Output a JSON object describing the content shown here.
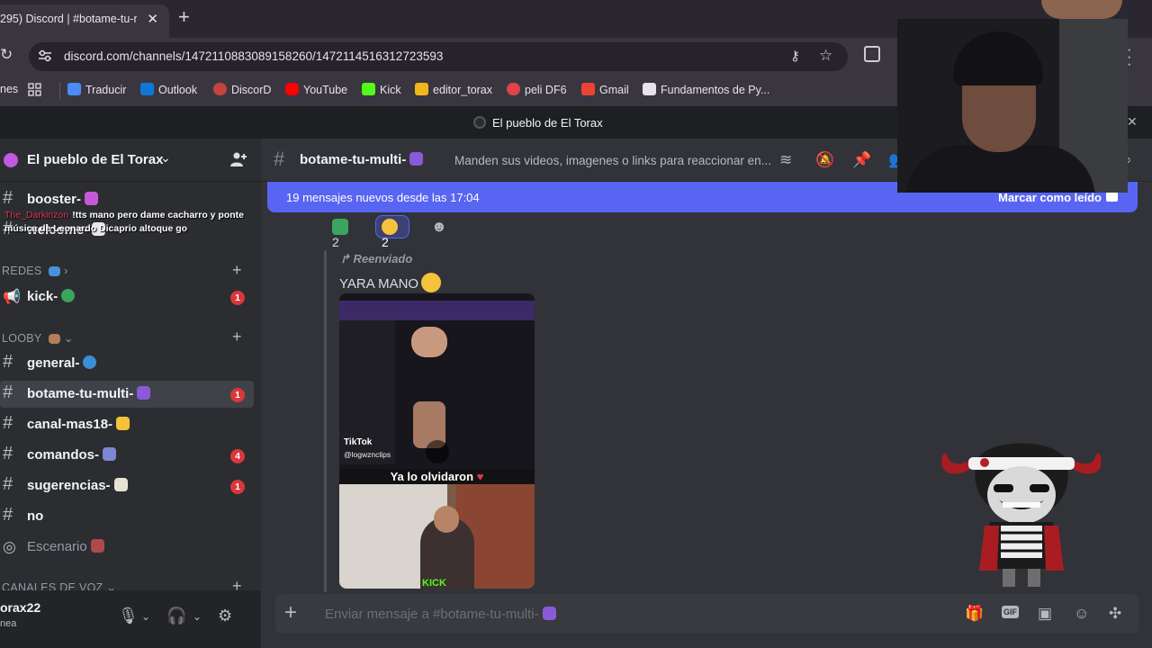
{
  "browser": {
    "tab_title": "295) Discord | #botame-tu-m",
    "url": "discord.com/channels/1472110883089158260/1472114516312723593",
    "bookmarks": [
      {
        "label": "nes",
        "color": "#3a3640"
      },
      {
        "label": "Traducir",
        "color": "#4c8bf5"
      },
      {
        "label": "Outlook",
        "color": "#0f78d4"
      },
      {
        "label": "DiscorD",
        "color": "#c4443d"
      },
      {
        "label": "YouTube",
        "color": "#ff0000"
      },
      {
        "label": "Kick",
        "color": "#53fc18"
      },
      {
        "label": "editor_torax",
        "color": "#f2b61c"
      },
      {
        "label": "peli DF6",
        "color": "#e0424a"
      },
      {
        "label": "Gmail",
        "color": "#ea4335"
      },
      {
        "label": "Fundamentos de Py...",
        "color": "#e6e4e8"
      }
    ]
  },
  "window": {
    "title": "El pueblo de El Torax"
  },
  "sidebar": {
    "guild_name": "El pueblo de El Torax",
    "channels_top": [
      {
        "name": "booster-",
        "emoji_color": "#c45ad7"
      },
      {
        "name": "welcome-",
        "emoji_color": "#e6e6f0"
      }
    ],
    "category_redes": "REDES",
    "channel_kick": {
      "name": "kick-",
      "badge": "1",
      "emoji_color": "#3ba55d"
    },
    "category_looby": "LOOBY",
    "looby_channels": [
      {
        "name": "general-",
        "badge": "",
        "emoji_color": "#3b8fd6"
      },
      {
        "name": "botame-tu-multi-",
        "badge": "1",
        "emoji_color": "#8a5ad8",
        "selected": true
      },
      {
        "name": "canal-mas18-",
        "badge": "",
        "emoji_color": "#f5c33b"
      },
      {
        "name": "comandos-",
        "badge": "4",
        "emoji_color": "#7d86d0"
      },
      {
        "name": "sugerencias-",
        "badge": "1",
        "emoji_color": "#e9e2d2"
      },
      {
        "name": "no",
        "badge": "",
        "emoji_color": ""
      }
    ],
    "stage_channel": {
      "name": "Escenario",
      "emoji_color": "#b04a4a"
    },
    "category_voice": "CANALES DE VOZ",
    "user": {
      "name": "orax22",
      "status": "nea"
    }
  },
  "stream_chat": {
    "user": "The_Darkinzon",
    "message": "!tts mano pero dame cacharro y ponte música de Leonardo Dicaprio altoque go"
  },
  "channel": {
    "name": "botame-tu-multi-",
    "topic": "Manden sus videos, imagenes o links para reaccionar en...",
    "new_messages": "19 mensajes nuevos desde las 17:04",
    "mark_read": "Marcar como leído"
  },
  "message": {
    "reactions": [
      {
        "count": "2",
        "color": "#3ba55d",
        "active": false
      },
      {
        "count": "2",
        "color": "#f5c33b",
        "active": true
      }
    ],
    "forwarded_label": "Reenviado",
    "text": "YARA MANO",
    "media": {
      "watermark": "TikTok",
      "handle": "@logwznclips",
      "caption": "Ya lo olvidaron",
      "kick_text": "KICK"
    }
  },
  "composer": {
    "placeholder": "Enviar mensaje a #botame-tu-multi-"
  }
}
